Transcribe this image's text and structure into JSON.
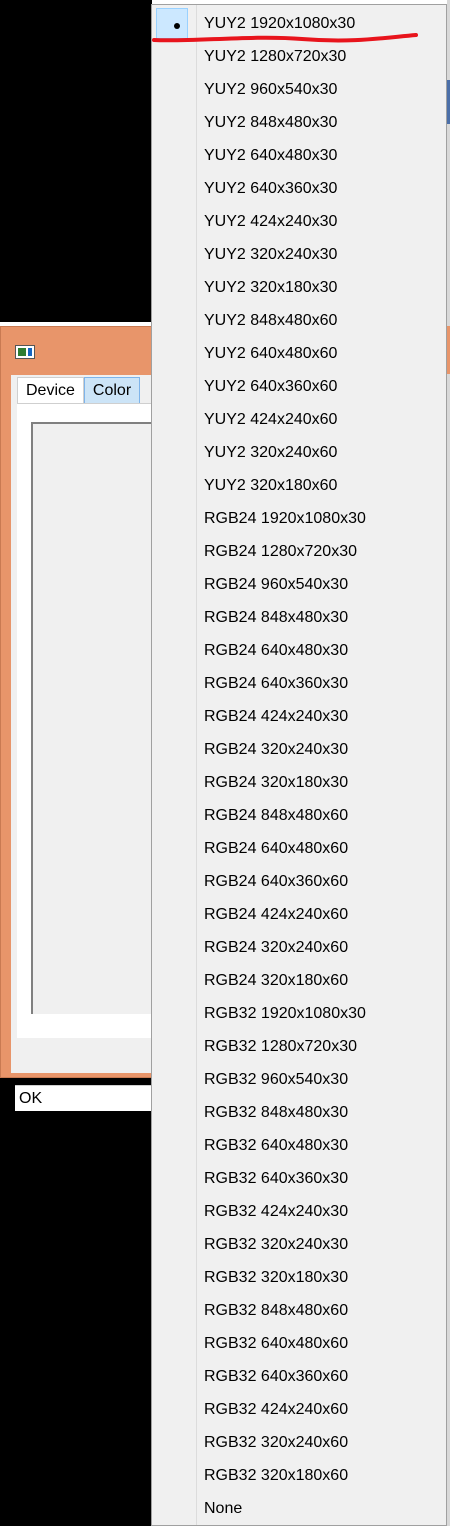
{
  "dialog": {
    "tabs": [
      {
        "label": "Device",
        "active": false
      },
      {
        "label": "Color",
        "active": true
      }
    ],
    "status_text": "OK"
  },
  "menu": {
    "selected_index": 0,
    "annotation_color": "#e8141c",
    "items": [
      {
        "label": "YUY2 1920x1080x30"
      },
      {
        "label": "YUY2 1280x720x30"
      },
      {
        "label": "YUY2 960x540x30"
      },
      {
        "label": "YUY2 848x480x30"
      },
      {
        "label": "YUY2 640x480x30"
      },
      {
        "label": "YUY2 640x360x30"
      },
      {
        "label": "YUY2 424x240x30"
      },
      {
        "label": "YUY2 320x240x30"
      },
      {
        "label": "YUY2 320x180x30"
      },
      {
        "label": "YUY2 848x480x60"
      },
      {
        "label": "YUY2 640x480x60"
      },
      {
        "label": "YUY2 640x360x60"
      },
      {
        "label": "YUY2 424x240x60"
      },
      {
        "label": "YUY2 320x240x60"
      },
      {
        "label": "YUY2 320x180x60"
      },
      {
        "label": "RGB24 1920x1080x30"
      },
      {
        "label": "RGB24 1280x720x30"
      },
      {
        "label": "RGB24 960x540x30"
      },
      {
        "label": "RGB24 848x480x30"
      },
      {
        "label": "RGB24 640x480x30"
      },
      {
        "label": "RGB24 640x360x30"
      },
      {
        "label": "RGB24 424x240x30"
      },
      {
        "label": "RGB24 320x240x30"
      },
      {
        "label": "RGB24 320x180x30"
      },
      {
        "label": "RGB24 848x480x60"
      },
      {
        "label": "RGB24 640x480x60"
      },
      {
        "label": "RGB24 640x360x60"
      },
      {
        "label": "RGB24 424x240x60"
      },
      {
        "label": "RGB24 320x240x60"
      },
      {
        "label": "RGB24 320x180x60"
      },
      {
        "label": "RGB32 1920x1080x30"
      },
      {
        "label": "RGB32 1280x720x30"
      },
      {
        "label": "RGB32 960x540x30"
      },
      {
        "label": "RGB32 848x480x30"
      },
      {
        "label": "RGB32 640x480x30"
      },
      {
        "label": "RGB32 640x360x30"
      },
      {
        "label": "RGB32 424x240x30"
      },
      {
        "label": "RGB32 320x240x30"
      },
      {
        "label": "RGB32 320x180x30"
      },
      {
        "label": "RGB32 848x480x60"
      },
      {
        "label": "RGB32 640x480x60"
      },
      {
        "label": "RGB32 640x360x60"
      },
      {
        "label": "RGB32 424x240x60"
      },
      {
        "label": "RGB32 320x240x60"
      },
      {
        "label": "RGB32 320x180x60"
      },
      {
        "label": "None"
      }
    ]
  }
}
